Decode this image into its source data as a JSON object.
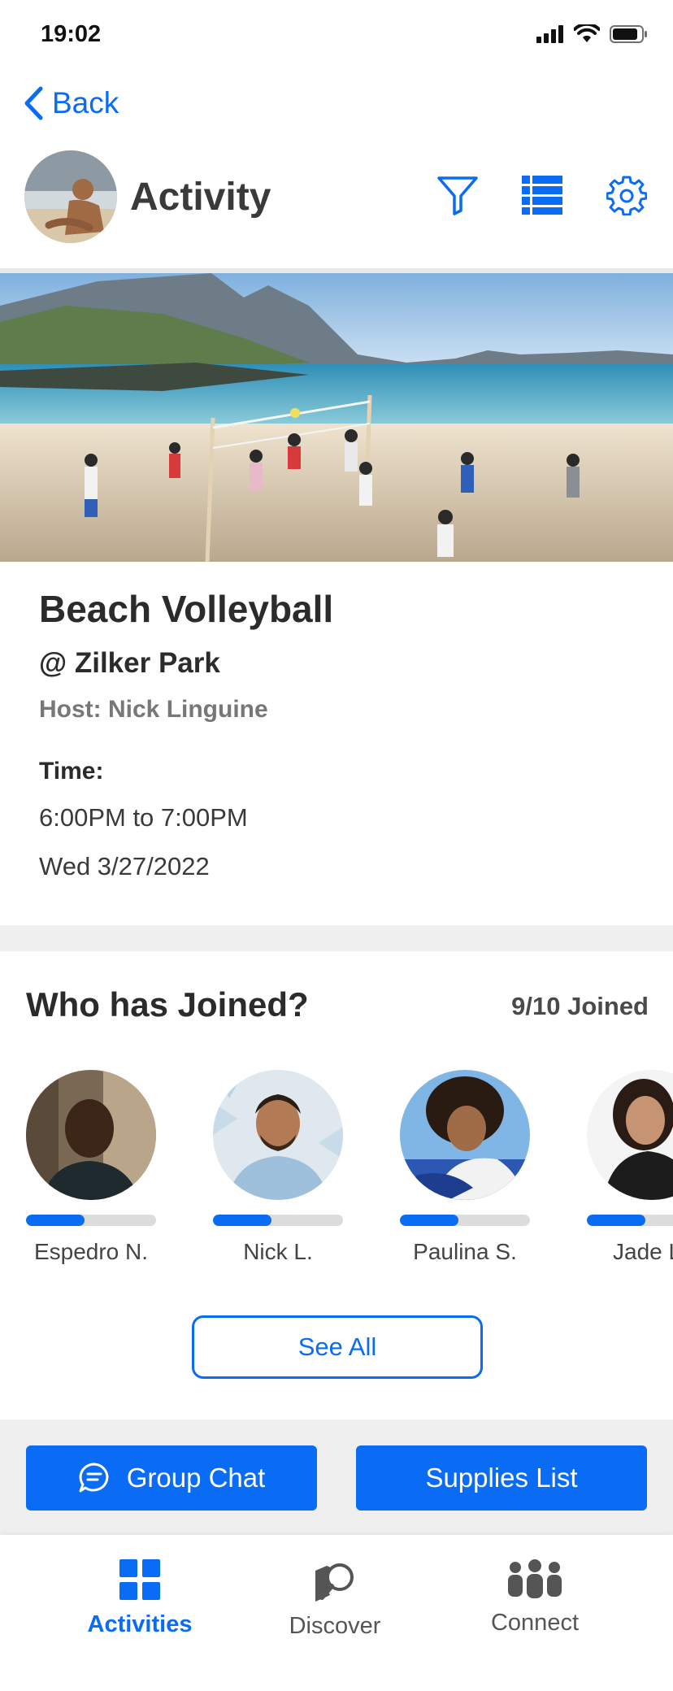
{
  "status_bar": {
    "time": "19:02"
  },
  "nav": {
    "back_label": "Back"
  },
  "header": {
    "title": "Activity"
  },
  "event": {
    "title": "Beach Volleyball",
    "location": "@ Zilker Park",
    "host": "Host: Nick Linguine",
    "time_label": "Time:",
    "time_range": "6:00PM to 7:00PM",
    "date": "Wed 3/27/2022"
  },
  "joined": {
    "title": "Who has Joined?",
    "count": "9/10 Joined",
    "people": [
      {
        "name": "Espedro N.",
        "progress": 0.45
      },
      {
        "name": "Nick L.",
        "progress": 0.45
      },
      {
        "name": "Paulina S.",
        "progress": 0.45
      },
      {
        "name": "Jade L",
        "progress": 0.45
      }
    ],
    "see_all_label": "See All"
  },
  "actions": {
    "group_chat_label": "Group Chat",
    "supplies_label": "Supplies List"
  },
  "bottom_nav": {
    "items": [
      {
        "label": "Activities",
        "active": true
      },
      {
        "label": "Discover",
        "active": false
      },
      {
        "label": "Connect",
        "active": false
      }
    ]
  },
  "colors": {
    "accent": "#0a6cf5",
    "divider": "#efefef"
  }
}
